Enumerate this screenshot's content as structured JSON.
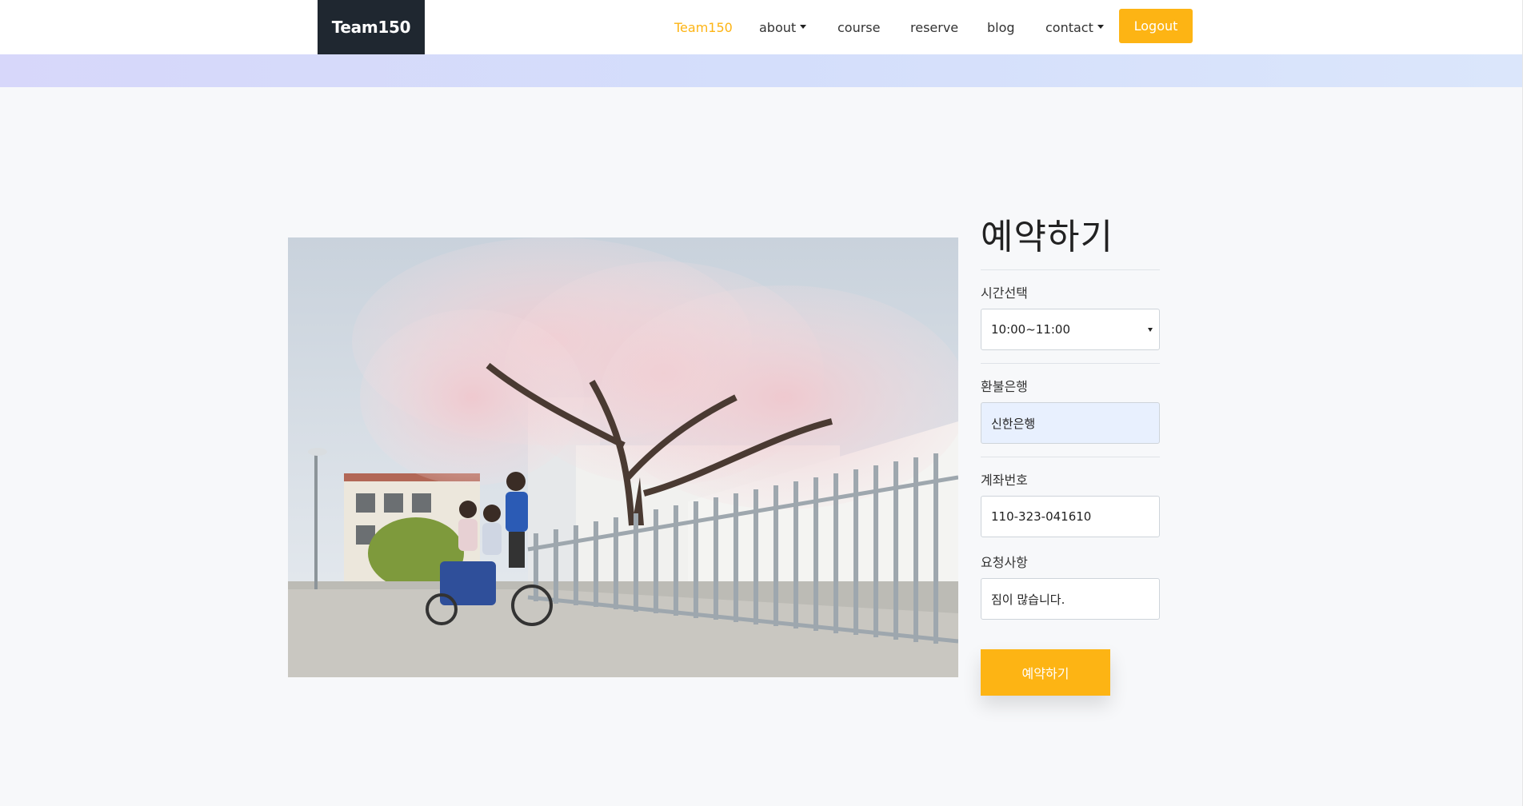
{
  "nav": {
    "brand": "Team150",
    "items": [
      {
        "label": "Team150",
        "active": true,
        "dropdown": false
      },
      {
        "label": "about",
        "active": false,
        "dropdown": true
      },
      {
        "label": "course",
        "active": false,
        "dropdown": false
      },
      {
        "label": "reserve",
        "active": false,
        "dropdown": false
      },
      {
        "label": "blog",
        "active": false,
        "dropdown": false
      },
      {
        "label": "contact",
        "active": false,
        "dropdown": true
      }
    ],
    "logout_label": "Logout"
  },
  "colors": {
    "accent": "#fdb414",
    "brand_bg": "#1f2730",
    "page_bg": "#f7f8fa",
    "autofill_bg": "#e8f0fe"
  },
  "form": {
    "title": "예약하기",
    "time_label": "시간선택",
    "time_value": "10:00~11:00",
    "bank_label": "환불은행",
    "bank_value": "신한은행",
    "account_label": "계좌번호",
    "account_value": "110-323-041610",
    "request_label": "요청사항",
    "request_value": "짐이 많습니다.",
    "submit_label": "예약하기"
  }
}
